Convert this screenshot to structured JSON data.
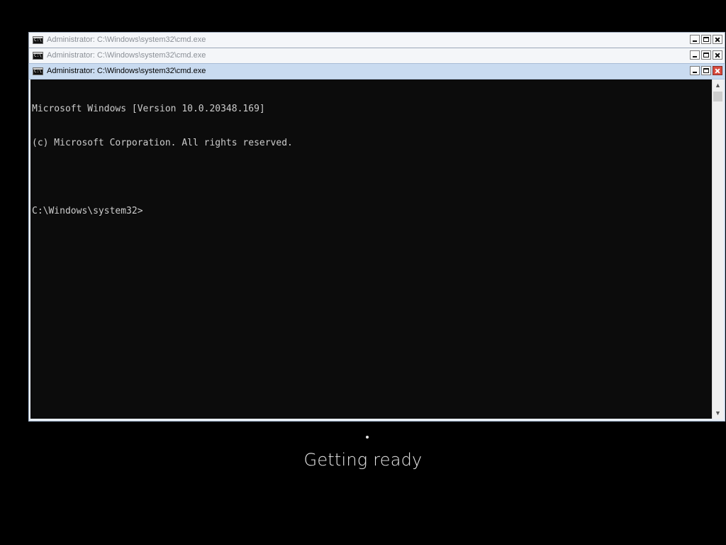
{
  "windows": [
    {
      "title": "Administrator: C:\\Windows\\system32\\cmd.exe",
      "icon": "cmd-icon",
      "state": "inactive"
    },
    {
      "title": "Administrator: C:\\Windows\\system32\\cmd.exe",
      "icon": "cmd-icon",
      "state": "inactive"
    },
    {
      "title": "Administrator: C:\\Windows\\system32\\cmd.exe",
      "icon": "cmd-icon",
      "state": "active"
    }
  ],
  "app_icon_glyph": "C:\\",
  "console": {
    "lines": [
      "Microsoft Windows [Version 10.0.20348.169]",
      "(c) Microsoft Corporation. All rights reserved.",
      "",
      "C:\\Windows\\system32>"
    ],
    "background": "#0c0c0c",
    "foreground": "#cccccc"
  },
  "scrollbar": {
    "up_arrow": "▲",
    "down_arrow": "▼"
  },
  "status": {
    "text": "Getting ready"
  },
  "colors": {
    "active_titlebar": "#c9dbf0",
    "close_button_active": "#d94a3d",
    "desktop_background": "#000000"
  }
}
